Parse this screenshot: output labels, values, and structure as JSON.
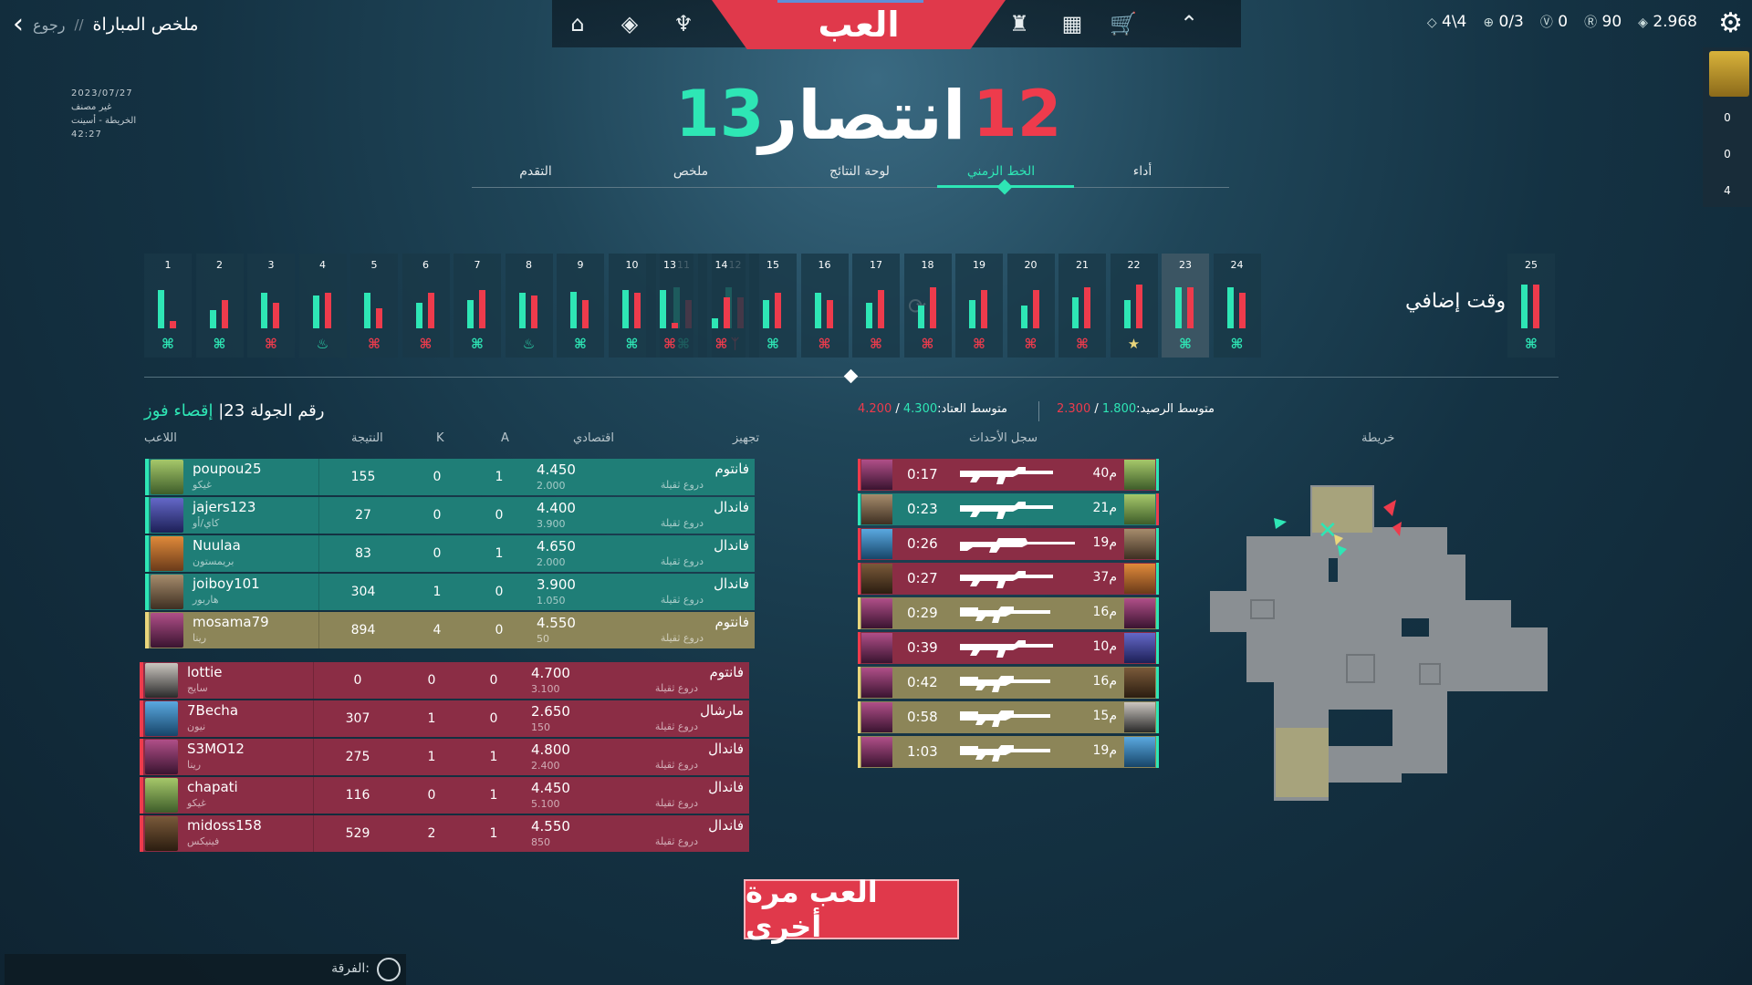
{
  "header": {
    "back_label": "رجوع",
    "separator": "//",
    "title": "ملخص المباراة",
    "play_label": "العب"
  },
  "currencies": [
    {
      "icon": "radianite-icon",
      "value": "4\\4"
    },
    {
      "icon": "plus-icon",
      "value": "0/3"
    },
    {
      "icon": "kingdom-icon",
      "value": "0"
    },
    {
      "icon": "radianite-points-icon",
      "value": "90"
    },
    {
      "icon": "valorant-points-icon",
      "value": "2.968"
    }
  ],
  "party": {
    "values": [
      "0",
      "0",
      "4"
    ]
  },
  "meta": {
    "date": "2023/07/27",
    "mode": "غير مصنف",
    "map": "الخريطة - أسينت",
    "duration": "42:27"
  },
  "score": {
    "left": "13",
    "right": "12",
    "result": "انتصار"
  },
  "tabs": [
    "أداء",
    "الخط الزمني",
    "لوحة النتائج",
    "ملخص",
    "التقدم"
  ],
  "overtime_label": "وقت إضافي",
  "rounds": [
    {
      "n": "1",
      "g": 0.75,
      "r": 0.15,
      "win": "g",
      "icon": "defuse"
    },
    {
      "n": "2",
      "g": 0.35,
      "r": 0.55,
      "win": "g",
      "icon": "defuse"
    },
    {
      "n": "3",
      "g": 0.7,
      "r": 0.5,
      "win": "r",
      "icon": "defuse"
    },
    {
      "n": "4",
      "g": 0.65,
      "r": 0.7,
      "win": "g",
      "icon": "detonate"
    },
    {
      "n": "5",
      "g": 0.7,
      "r": 0.4,
      "win": "r",
      "icon": "defuse"
    },
    {
      "n": "6",
      "g": 0.5,
      "r": 0.7,
      "win": "r",
      "icon": "defuse"
    },
    {
      "n": "7",
      "g": 0.55,
      "r": 0.75,
      "win": "g",
      "icon": "defuse"
    },
    {
      "n": "8",
      "g": 0.7,
      "r": 0.65,
      "win": "g",
      "icon": "detonate"
    },
    {
      "n": "9",
      "g": 0.72,
      "r": 0.55,
      "win": "g",
      "icon": "defuse"
    },
    {
      "n": "10",
      "g": 0.75,
      "r": 0.7,
      "win": "g",
      "icon": "defuse"
    },
    {
      "n": "11",
      "g": 0.8,
      "r": 0.55,
      "win": "g",
      "icon": "defuse"
    },
    {
      "n": "12",
      "g": 0.8,
      "r": 0.6,
      "win": "r",
      "icon": "attack"
    },
    {
      "n": "13",
      "g": 0.75,
      "r": 0.1,
      "win": "r",
      "icon": "defuse"
    },
    {
      "n": "14",
      "g": 0.2,
      "r": 0.6,
      "win": "r",
      "icon": "defuse"
    },
    {
      "n": "15",
      "g": 0.55,
      "r": 0.7,
      "win": "g",
      "icon": "defuse"
    },
    {
      "n": "16",
      "g": 0.7,
      "r": 0.55,
      "win": "r",
      "icon": "defuse"
    },
    {
      "n": "17",
      "g": 0.5,
      "r": 0.75,
      "win": "r",
      "icon": "defuse"
    },
    {
      "n": "18",
      "g": 0.45,
      "r": 0.8,
      "win": "r",
      "icon": "defuse"
    },
    {
      "n": "19",
      "g": 0.55,
      "r": 0.75,
      "win": "r",
      "icon": "defuse"
    },
    {
      "n": "20",
      "g": 0.45,
      "r": 0.75,
      "win": "r",
      "icon": "defuse"
    },
    {
      "n": "21",
      "g": 0.6,
      "r": 0.8,
      "win": "r",
      "icon": "defuse"
    },
    {
      "n": "22",
      "g": 0.55,
      "r": 0.85,
      "win": "y",
      "icon": "star"
    },
    {
      "n": "23",
      "g": 0.8,
      "r": 0.8,
      "win": "g",
      "icon": "defuse"
    },
    {
      "n": "24",
      "g": 0.8,
      "r": 0.7,
      "win": "g",
      "icon": "defuse"
    },
    {
      "n": "25",
      "g": 0.85,
      "r": 0.85,
      "win": "g",
      "icon": "defuse"
    }
  ],
  "round_summary": {
    "number": "23",
    "label": "رقم الجولة",
    "win_type": "إقصاء فوز",
    "separator": "|"
  },
  "averages": {
    "loadout_label": "متوسط العتاد:",
    "loadout_g": "4.300",
    "loadout_r": "4.200",
    "bank_label": "متوسط الرصيد:",
    "bank_g": "1.800",
    "bank_r": "2.300",
    "slash": "/"
  },
  "columns": {
    "player": "اللاعب",
    "score": "النتيجة",
    "k": "K",
    "a": "A",
    "econ": "اقتصادي",
    "loadout": "تجهيز",
    "feed": "سجل الأحداث",
    "map": "خريطة"
  },
  "team_win": [
    {
      "name": "poupou25",
      "agent": "غيكو",
      "score": "155",
      "k": "0",
      "a": "1",
      "econ": "4.450",
      "rem": "2.000",
      "weapon": "فانتوم",
      "shield": "دروع ثقيلة",
      "av": "av-a",
      "cls": "win"
    },
    {
      "name": "jajers123",
      "agent": "كاي/أو",
      "score": "27",
      "k": "0",
      "a": "0",
      "econ": "4.400",
      "rem": "3.900",
      "weapon": "فاندال",
      "shield": "دروع ثقيلة",
      "av": "av-b",
      "cls": "win"
    },
    {
      "name": "Nuulaa",
      "agent": "بريمستون",
      "score": "83",
      "k": "0",
      "a": "1",
      "econ": "4.650",
      "rem": "2.000",
      "weapon": "فاندال",
      "shield": "دروع ثقيلة",
      "av": "av-c",
      "cls": "win"
    },
    {
      "name": "joiboy101",
      "agent": "هاربور",
      "score": "304",
      "k": "1",
      "a": "0",
      "econ": "3.900",
      "rem": "1.050",
      "weapon": "فاندال",
      "shield": "دروع ثقيلة",
      "av": "av-d",
      "cls": "win"
    },
    {
      "name": "mosama79",
      "agent": "رينا",
      "score": "894",
      "k": "4",
      "a": "0",
      "econ": "4.550",
      "rem": "50",
      "weapon": "فانتوم",
      "shield": "دروع ثقيلة",
      "av": "av-e",
      "cls": "mine"
    }
  ],
  "team_loss": [
    {
      "name": "lottie",
      "agent": "سايج",
      "score": "0",
      "k": "0",
      "a": "0",
      "econ": "4.700",
      "rem": "3.100",
      "weapon": "فانتوم",
      "shield": "دروع ثقيلة",
      "av": "av-f",
      "cls": "loss"
    },
    {
      "name": "7Becha",
      "agent": "نيون",
      "score": "307",
      "k": "1",
      "a": "0",
      "econ": "2.650",
      "rem": "150",
      "weapon": "مارشال",
      "shield": "دروع ثقيلة",
      "av": "av-g",
      "cls": "loss"
    },
    {
      "name": "S3MO12",
      "agent": "رينا",
      "score": "275",
      "k": "1",
      "a": "1",
      "econ": "4.800",
      "rem": "2.400",
      "weapon": "فاندال",
      "shield": "دروع ثقيلة",
      "av": "av-e",
      "cls": "loss"
    },
    {
      "name": "chapati",
      "agent": "غيكو",
      "score": "116",
      "k": "0",
      "a": "1",
      "econ": "4.450",
      "rem": "5.100",
      "weapon": "فاندال",
      "shield": "دروع ثقيلة",
      "av": "av-a",
      "cls": "loss"
    },
    {
      "name": "midoss158",
      "agent": "فينيكس",
      "score": "529",
      "k": "2",
      "a": "1",
      "econ": "4.550",
      "rem": "850",
      "weapon": "فاندال",
      "shield": "دروع ثقيلة",
      "av": "av-i",
      "cls": "loss"
    }
  ],
  "kills": [
    {
      "time": "0:17",
      "dist": "40م",
      "cls": "loss",
      "gun": "rifle",
      "ka": "av-e",
      "va": "av-a"
    },
    {
      "time": "0:23",
      "dist": "21م",
      "cls": "win",
      "gun": "rifle",
      "ka": "av-d",
      "va": "av-a"
    },
    {
      "time": "0:26",
      "dist": "19م",
      "cls": "loss",
      "gun": "sniper",
      "ka": "av-g",
      "va": "av-d"
    },
    {
      "time": "0:27",
      "dist": "37م",
      "cls": "loss",
      "gun": "rifle",
      "ka": "av-i",
      "va": "av-c"
    },
    {
      "time": "0:29",
      "dist": "16م",
      "cls": "mine",
      "gun": "vandal",
      "ka": "av-e",
      "va": "av-e"
    },
    {
      "time": "0:39",
      "dist": "10م",
      "cls": "loss",
      "gun": "rifle",
      "ka": "av-e",
      "va": "av-b"
    },
    {
      "time": "0:42",
      "dist": "16م",
      "cls": "mine",
      "gun": "vandal",
      "ka": "av-e",
      "va": "av-i"
    },
    {
      "time": "0:58",
      "dist": "15م",
      "cls": "mine",
      "gun": "vandal",
      "ka": "av-e",
      "va": "av-f"
    },
    {
      "time": "1:03",
      "dist": "19م",
      "cls": "mine",
      "gun": "vandal",
      "ka": "av-e",
      "va": "av-g"
    }
  ],
  "play_again": "العب مرة أخرى",
  "chat": {
    "label": "الفرقة:"
  },
  "colors": {
    "green": "#2ee6b5",
    "red": "#ee3b4c",
    "gold": "#e9d67c"
  }
}
